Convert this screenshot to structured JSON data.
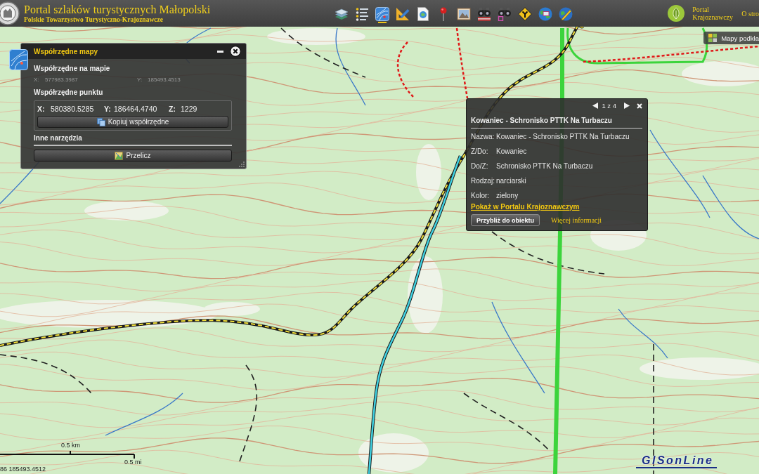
{
  "header": {
    "title": "Portal szlaków turystycznych Małopolski",
    "subtitle": "Polskie Towarzystwo Turystyczno-Krajoznawcze",
    "toolbar": [
      {
        "kind": "layers",
        "selected": false
      },
      {
        "kind": "legend",
        "selected": false
      },
      {
        "kind": "coordinates",
        "selected": true
      },
      {
        "kind": "measure",
        "selected": false
      },
      {
        "kind": "print",
        "selected": false
      },
      {
        "kind": "pin",
        "selected": false
      },
      {
        "kind": "image",
        "selected": false
      },
      {
        "kind": "find",
        "selected": false
      },
      {
        "kind": "findarea",
        "selected": false
      },
      {
        "kind": "route",
        "selected": false
      },
      {
        "kind": "globe",
        "selected": false
      },
      {
        "kind": "edit",
        "selected": false
      }
    ],
    "links": [
      {
        "kind": "portal",
        "label": "Portal Krajoznawczy"
      },
      {
        "kind": "plain",
        "label": "O stro"
      }
    ]
  },
  "basemap_button": {
    "label": "Mapy podkła"
  },
  "coords_panel": {
    "title": "Współrzędne mapy",
    "map_heading": "Współrzędne na mapie",
    "map_fields": [
      {
        "label": "X:",
        "value": "577983.3987"
      },
      {
        "label": "Y:",
        "value": "185493.4513"
      }
    ],
    "point_heading": "Współrzędne punktu",
    "point_fields": [
      {
        "label": "X:",
        "value": "580380.5285"
      },
      {
        "label": "Y:",
        "value": "186464.4740"
      },
      {
        "label": "Z:",
        "value": "1229"
      }
    ],
    "copy_button": "Kopiuj współrzędne",
    "tools_heading": "Inne narzędzia",
    "convert_button": "Przelicz"
  },
  "popup": {
    "pager": "1 z 4",
    "title": "Kowaniec - Schronisko PTTK Na Turbaczu",
    "fields": [
      {
        "label": "Nazwa:",
        "value": "Kowaniec - Schronisko PTTK Na Turbaczu"
      },
      {
        "label": "Z/Do:",
        "value": "Kowaniec"
      },
      {
        "label": "Do/Z:",
        "value": "Schronisko PTTK Na Turbaczu"
      },
      {
        "label": "Rodzaj:",
        "value": "narciarski"
      },
      {
        "label": "Kolor:",
        "value": "zielony"
      }
    ],
    "link": "Pokaż w Portalu Krajoznawczym",
    "zoom_button": "Przybliż do obiektu",
    "more_link": "Więcej informacji"
  },
  "scale": {
    "km": "0.5 km",
    "mi": "0.5 mi"
  },
  "cursor_coordinates": "86 185493.4512",
  "logo": "GISonLine"
}
